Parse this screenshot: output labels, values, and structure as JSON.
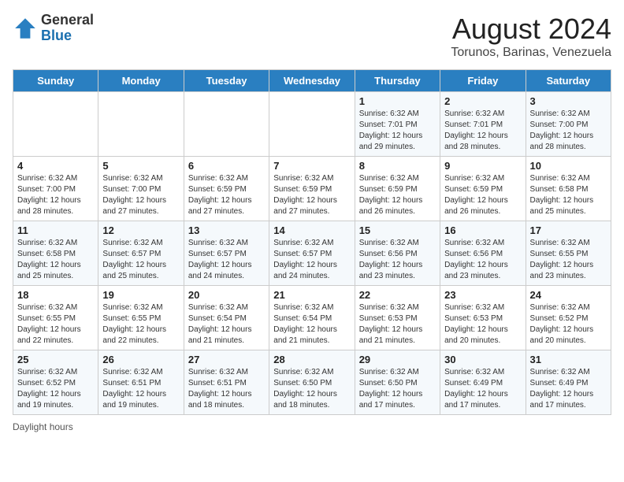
{
  "header": {
    "logo_general": "General",
    "logo_blue": "Blue",
    "month_year": "August 2024",
    "location": "Torunos, Barinas, Venezuela"
  },
  "days_of_week": [
    "Sunday",
    "Monday",
    "Tuesday",
    "Wednesday",
    "Thursday",
    "Friday",
    "Saturday"
  ],
  "weeks": [
    [
      {
        "num": "",
        "detail": ""
      },
      {
        "num": "",
        "detail": ""
      },
      {
        "num": "",
        "detail": ""
      },
      {
        "num": "",
        "detail": ""
      },
      {
        "num": "1",
        "detail": "Sunrise: 6:32 AM\nSunset: 7:01 PM\nDaylight: 12 hours\nand 29 minutes."
      },
      {
        "num": "2",
        "detail": "Sunrise: 6:32 AM\nSunset: 7:01 PM\nDaylight: 12 hours\nand 28 minutes."
      },
      {
        "num": "3",
        "detail": "Sunrise: 6:32 AM\nSunset: 7:00 PM\nDaylight: 12 hours\nand 28 minutes."
      }
    ],
    [
      {
        "num": "4",
        "detail": "Sunrise: 6:32 AM\nSunset: 7:00 PM\nDaylight: 12 hours\nand 28 minutes."
      },
      {
        "num": "5",
        "detail": "Sunrise: 6:32 AM\nSunset: 7:00 PM\nDaylight: 12 hours\nand 27 minutes."
      },
      {
        "num": "6",
        "detail": "Sunrise: 6:32 AM\nSunset: 6:59 PM\nDaylight: 12 hours\nand 27 minutes."
      },
      {
        "num": "7",
        "detail": "Sunrise: 6:32 AM\nSunset: 6:59 PM\nDaylight: 12 hours\nand 27 minutes."
      },
      {
        "num": "8",
        "detail": "Sunrise: 6:32 AM\nSunset: 6:59 PM\nDaylight: 12 hours\nand 26 minutes."
      },
      {
        "num": "9",
        "detail": "Sunrise: 6:32 AM\nSunset: 6:59 PM\nDaylight: 12 hours\nand 26 minutes."
      },
      {
        "num": "10",
        "detail": "Sunrise: 6:32 AM\nSunset: 6:58 PM\nDaylight: 12 hours\nand 25 minutes."
      }
    ],
    [
      {
        "num": "11",
        "detail": "Sunrise: 6:32 AM\nSunset: 6:58 PM\nDaylight: 12 hours\nand 25 minutes."
      },
      {
        "num": "12",
        "detail": "Sunrise: 6:32 AM\nSunset: 6:57 PM\nDaylight: 12 hours\nand 25 minutes."
      },
      {
        "num": "13",
        "detail": "Sunrise: 6:32 AM\nSunset: 6:57 PM\nDaylight: 12 hours\nand 24 minutes."
      },
      {
        "num": "14",
        "detail": "Sunrise: 6:32 AM\nSunset: 6:57 PM\nDaylight: 12 hours\nand 24 minutes."
      },
      {
        "num": "15",
        "detail": "Sunrise: 6:32 AM\nSunset: 6:56 PM\nDaylight: 12 hours\nand 23 minutes."
      },
      {
        "num": "16",
        "detail": "Sunrise: 6:32 AM\nSunset: 6:56 PM\nDaylight: 12 hours\nand 23 minutes."
      },
      {
        "num": "17",
        "detail": "Sunrise: 6:32 AM\nSunset: 6:55 PM\nDaylight: 12 hours\nand 23 minutes."
      }
    ],
    [
      {
        "num": "18",
        "detail": "Sunrise: 6:32 AM\nSunset: 6:55 PM\nDaylight: 12 hours\nand 22 minutes."
      },
      {
        "num": "19",
        "detail": "Sunrise: 6:32 AM\nSunset: 6:55 PM\nDaylight: 12 hours\nand 22 minutes."
      },
      {
        "num": "20",
        "detail": "Sunrise: 6:32 AM\nSunset: 6:54 PM\nDaylight: 12 hours\nand 21 minutes."
      },
      {
        "num": "21",
        "detail": "Sunrise: 6:32 AM\nSunset: 6:54 PM\nDaylight: 12 hours\nand 21 minutes."
      },
      {
        "num": "22",
        "detail": "Sunrise: 6:32 AM\nSunset: 6:53 PM\nDaylight: 12 hours\nand 21 minutes."
      },
      {
        "num": "23",
        "detail": "Sunrise: 6:32 AM\nSunset: 6:53 PM\nDaylight: 12 hours\nand 20 minutes."
      },
      {
        "num": "24",
        "detail": "Sunrise: 6:32 AM\nSunset: 6:52 PM\nDaylight: 12 hours\nand 20 minutes."
      }
    ],
    [
      {
        "num": "25",
        "detail": "Sunrise: 6:32 AM\nSunset: 6:52 PM\nDaylight: 12 hours\nand 19 minutes."
      },
      {
        "num": "26",
        "detail": "Sunrise: 6:32 AM\nSunset: 6:51 PM\nDaylight: 12 hours\nand 19 minutes."
      },
      {
        "num": "27",
        "detail": "Sunrise: 6:32 AM\nSunset: 6:51 PM\nDaylight: 12 hours\nand 18 minutes."
      },
      {
        "num": "28",
        "detail": "Sunrise: 6:32 AM\nSunset: 6:50 PM\nDaylight: 12 hours\nand 18 minutes."
      },
      {
        "num": "29",
        "detail": "Sunrise: 6:32 AM\nSunset: 6:50 PM\nDaylight: 12 hours\nand 17 minutes."
      },
      {
        "num": "30",
        "detail": "Sunrise: 6:32 AM\nSunset: 6:49 PM\nDaylight: 12 hours\nand 17 minutes."
      },
      {
        "num": "31",
        "detail": "Sunrise: 6:32 AM\nSunset: 6:49 PM\nDaylight: 12 hours\nand 17 minutes."
      }
    ]
  ],
  "footer": {
    "daylight_label": "Daylight hours"
  }
}
